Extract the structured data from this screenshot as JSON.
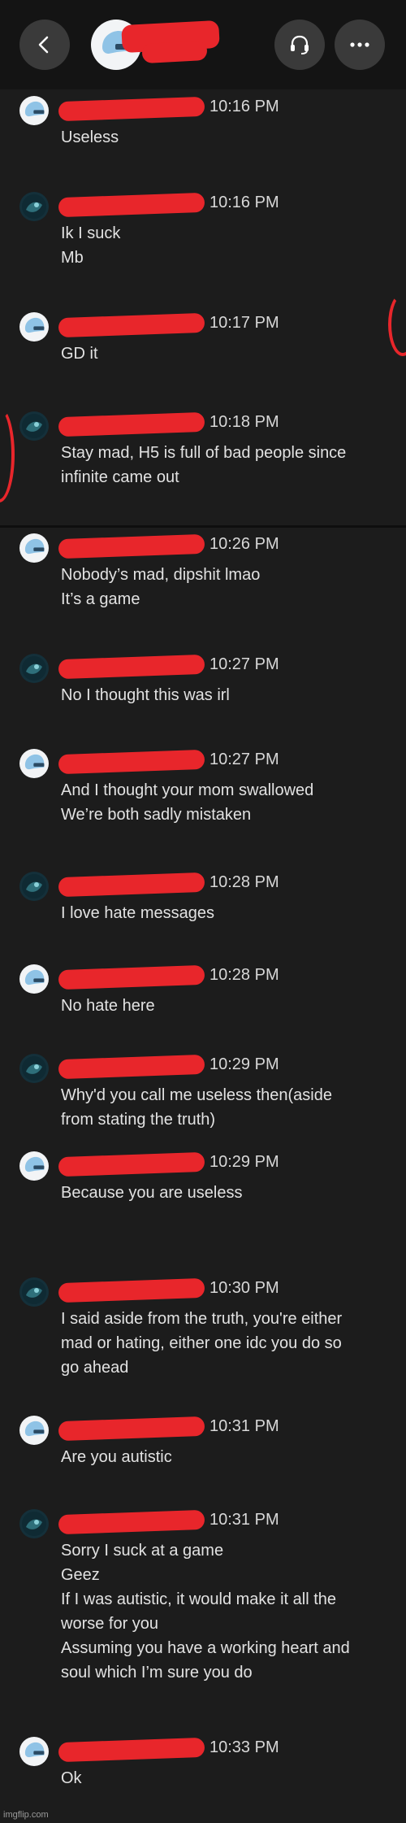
{
  "header": {
    "back_icon": "chevron-left-icon",
    "headset_icon": "headset-icon",
    "more_icon": "more-horizontal-icon"
  },
  "messages": [
    {
      "avatar": "light",
      "time": "10:16 PM",
      "lines": [
        "Useless"
      ]
    },
    {
      "avatar": "dark",
      "time": "10:16 PM",
      "lines": [
        "Ik I suck",
        "Mb"
      ]
    },
    {
      "avatar": "light",
      "time": "10:17 PM",
      "lines": [
        "GD it"
      ]
    },
    {
      "avatar": "dark",
      "time": "10:18 PM",
      "lines": [
        "Stay mad, H5 is full of bad people since",
        "infinite came out"
      ]
    },
    {
      "avatar": "light",
      "time": "10:26 PM",
      "lines": [
        "Nobody’s mad, dipshit lmao",
        "It’s a game"
      ]
    },
    {
      "avatar": "dark",
      "time": "10:27 PM",
      "lines": [
        "No I thought this was irl"
      ]
    },
    {
      "avatar": "light",
      "time": "10:27 PM",
      "lines": [
        "And I thought your mom swallowed",
        "We’re both sadly mistaken"
      ]
    },
    {
      "avatar": "dark",
      "time": "10:28 PM",
      "lines": [
        "I love hate messages"
      ]
    },
    {
      "avatar": "light",
      "time": "10:28 PM",
      "lines": [
        "No hate here"
      ]
    },
    {
      "avatar": "dark",
      "time": "10:29 PM",
      "lines": [
        "Why'd you call me useless then(aside",
        "from stating the truth)"
      ]
    },
    {
      "avatar": "light",
      "time": "10:29 PM",
      "lines": [
        "Because you are useless"
      ]
    },
    {
      "avatar": "dark",
      "time": "10:30 PM",
      "lines": [
        "I said aside from the truth, you're either",
        "mad or hating, either one idc you do so",
        "go ahead"
      ]
    },
    {
      "avatar": "light",
      "time": "10:31 PM",
      "lines": [
        "Are you autistic"
      ]
    },
    {
      "avatar": "dark",
      "time": "10:31 PM",
      "lines": [
        "Sorry I suck at a game",
        "Geez",
        "If I was autistic, it would make it all the",
        "worse for you",
        "Assuming you have a working heart and",
        "soul which I’m sure you do"
      ]
    },
    {
      "avatar": "light",
      "time": "10:33 PM",
      "lines": [
        "Ok"
      ]
    }
  ],
  "footer": {
    "watermark": "imgflip.com"
  }
}
